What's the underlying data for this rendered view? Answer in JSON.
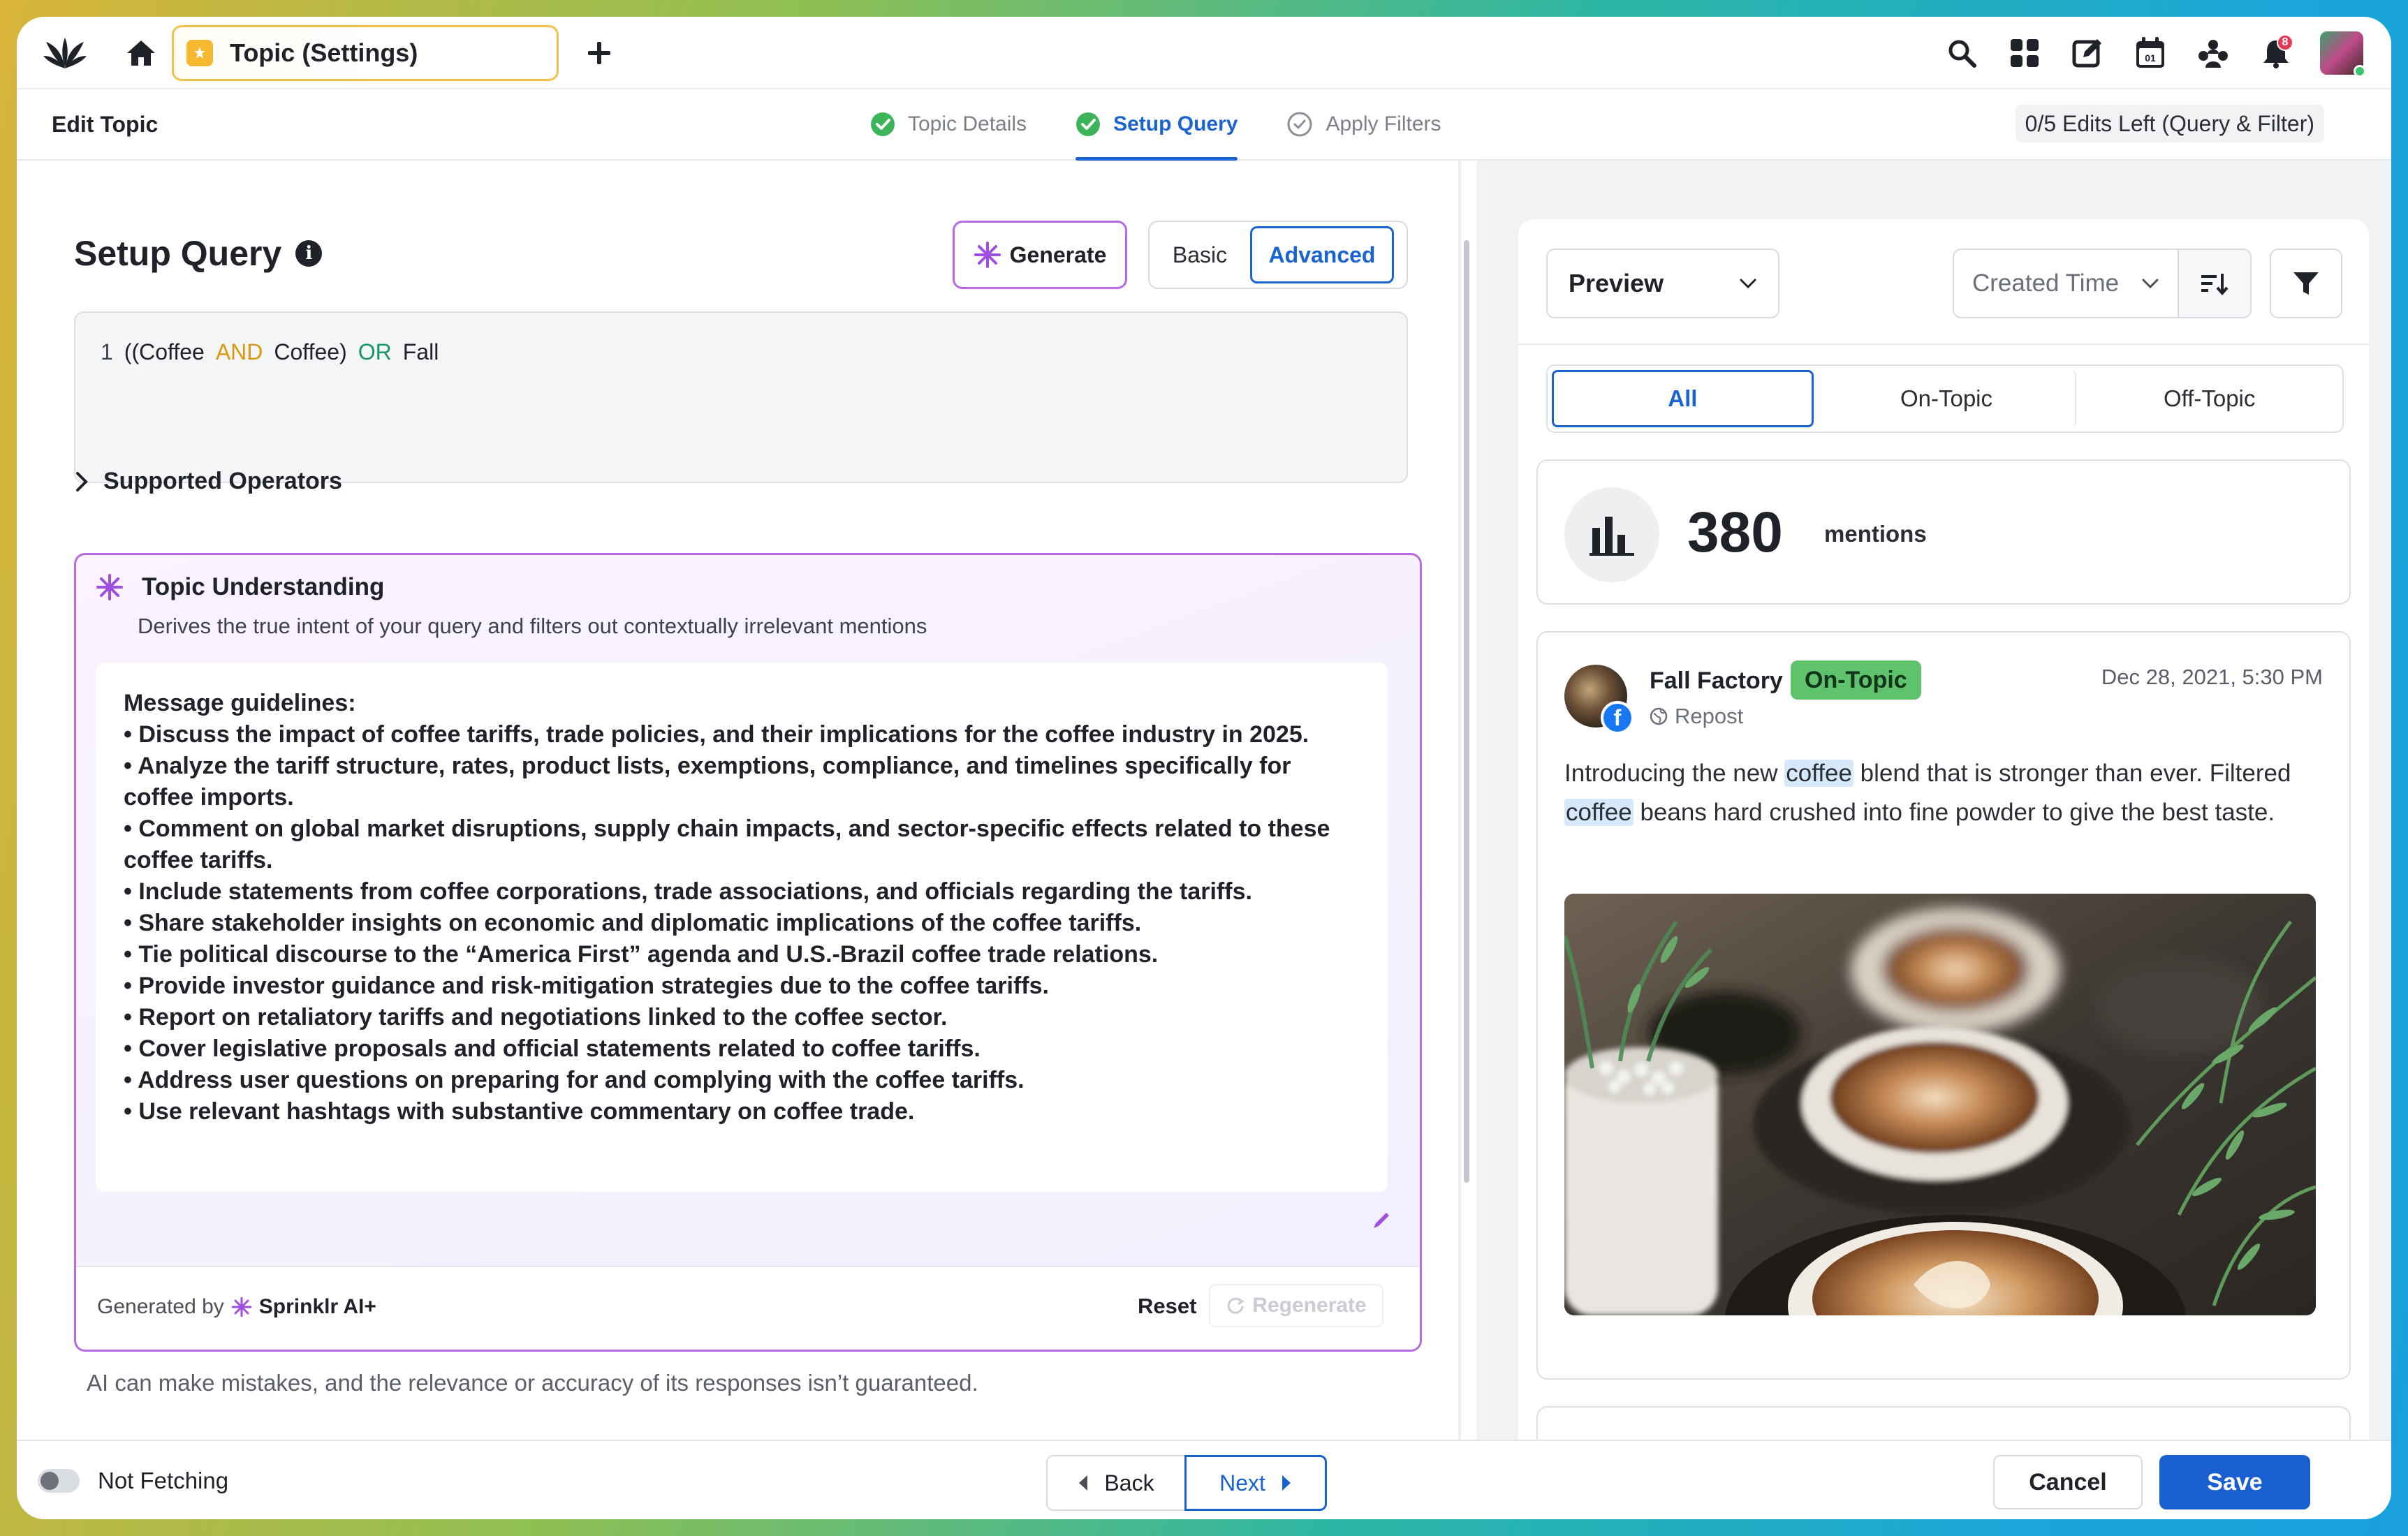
{
  "topnav": {
    "tab_label": "Topic (Settings)",
    "notification_count": "8",
    "icons": [
      "sprinklr-logo-icon",
      "home-icon",
      "add-tab-icon",
      "search-icon",
      "grid-icon",
      "compose-icon",
      "calendar-icon",
      "community-icon",
      "bell-icon"
    ]
  },
  "subheader": {
    "title": "Edit Topic",
    "steps": [
      {
        "label": "Topic Details",
        "state": "done"
      },
      {
        "label": "Setup Query",
        "state": "active"
      },
      {
        "label": "Apply Filters",
        "state": "pending"
      }
    ],
    "edits_left": "0/5 Edits Left (Query & Filter)"
  },
  "left": {
    "title": "Setup Query",
    "generate_label": "Generate",
    "mode_basic": "Basic",
    "mode_advanced": "Advanced",
    "query": {
      "line_no": "1",
      "part1": "((Coffee",
      "and": "AND",
      "part2": "Coffee)",
      "or": "OR",
      "part3": "Fall"
    },
    "supported_operators": "Supported Operators",
    "topic_understanding": {
      "title": "Topic Understanding",
      "subtitle": "Derives the true intent of your query and filters out contextually irrelevant mentions",
      "guidelines": [
        "Message guidelines:",
        "• Discuss the impact of coffee tariffs, trade policies, and their implications for the coffee industry in 2025.",
        "• Analyze the tariff structure, rates, product lists, exemptions, compliance, and timelines specifically for coffee imports.",
        "• Comment on global market disruptions, supply chain impacts, and sector-specific effects related to these coffee tariffs.",
        "• Include statements from coffee corporations, trade associations, and officials regarding the tariffs.",
        "• Share stakeholder insights on economic and diplomatic implications of the coffee tariffs.",
        "• Tie political discourse to the “America First” agenda and U.S.-Brazil coffee trade relations.",
        "• Provide investor guidance and risk-mitigation strategies due to the coffee tariffs.",
        "• Report on retaliatory tariffs and negotiations linked to the coffee sector.",
        "• Cover legislative proposals and official statements related to coffee tariffs.",
        "• Address user questions on preparing for and complying with the coffee tariffs.",
        "• Use relevant hashtags with substantive commentary on coffee trade."
      ],
      "generated_by_prefix": "Generated by",
      "generated_by_brand": "Sprinklr AI+",
      "reset_label": "Reset",
      "regenerate_label": "Regenerate"
    },
    "disclaimer": "AI can make mistakes, and the relevance or accuracy of its responses isn’t guaranteed."
  },
  "right": {
    "preview_label": "Preview",
    "sort_label": "Created Time",
    "tabs": [
      "All",
      "On-Topic",
      "Off-Topic"
    ],
    "mentions_count": "380",
    "mentions_label": "mentions",
    "post": {
      "author": "Fall Factory",
      "badge": "On-Topic",
      "date": "Dec 28, 2021, 5:30 PM",
      "type": "Repost",
      "text_1": "Introducing the new",
      "hl_1": "coffee",
      "text_2": "blend that is stronger than ever. Filtered",
      "hl_2": "coffee",
      "text_3": "beans hard crushed into fine powder to give the best taste."
    }
  },
  "footer": {
    "fetch_status": "Not Fetching",
    "back_label": "Back",
    "next_label": "Next",
    "cancel_label": "Cancel",
    "save_label": "Save"
  },
  "colors": {
    "accent": "#1a63d1",
    "ai_purple": "#b66be6",
    "on_topic": "#5fc36e",
    "and_operator": "#d99a12",
    "or_operator": "#17946a"
  }
}
